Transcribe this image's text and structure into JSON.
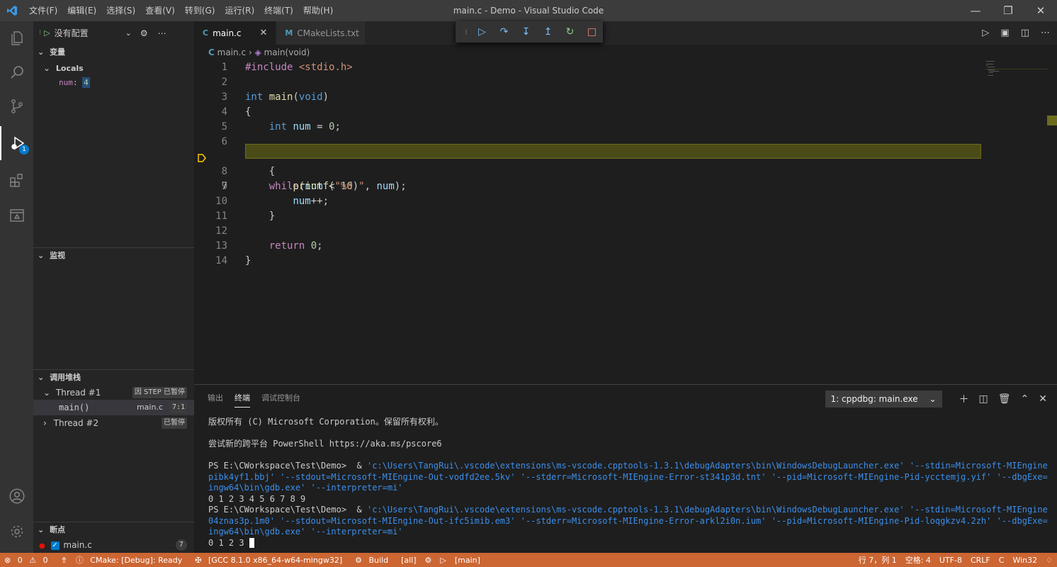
{
  "title_bar": {
    "menu": [
      "文件(F)",
      "编辑(E)",
      "选择(S)",
      "查看(V)",
      "转到(G)",
      "运行(R)",
      "终端(T)",
      "帮助(H)"
    ],
    "window_title": "main.c - Demo - Visual Studio Code"
  },
  "activity_bar": {
    "debug_badge": "1"
  },
  "sidebar": {
    "config_label": "没有配置",
    "variables_header": "变量",
    "locals_label": "Locals",
    "locals": [
      {
        "name": "num",
        "value": "4"
      }
    ],
    "watch_header": "监视",
    "callstack_header": "调用堆栈",
    "threads": [
      {
        "name": "Thread #1",
        "status": "因 STEP 已暂停"
      },
      {
        "name": "Thread #2",
        "status": "已暂停"
      }
    ],
    "frame": {
      "name": "main()",
      "file": "main.c",
      "pos": "7:1"
    },
    "breakpoints_header": "断点",
    "breakpoint": {
      "file": "main.c",
      "count": "7"
    }
  },
  "editor": {
    "tabs": [
      {
        "label": "main.c",
        "icon": "C"
      },
      {
        "label": "CMakeLists.txt",
        "icon": "M"
      }
    ],
    "breadcrumb": {
      "file": "main.c",
      "symbol": "main(void)"
    },
    "line_numbers": [
      "1",
      "2",
      "3",
      "4",
      "5",
      "6",
      "7",
      "8",
      "9",
      "10",
      "11",
      "12",
      "13",
      "14"
    ],
    "current_line": "7"
  },
  "panel": {
    "tabs": [
      "输出",
      "终端",
      "调试控制台"
    ],
    "active_tab": "终端",
    "terminal_select": "1: cppdbg: main.exe",
    "terminal_lines": [
      {
        "text": "版权所有 (C) Microsoft Corporation。保留所有权利。",
        "color": "plain"
      },
      {
        "text": "",
        "color": "plain"
      },
      {
        "text": "尝试新的跨平台 PowerShell https://aka.ms/pscore6",
        "color": "plain"
      },
      {
        "text": "",
        "color": "plain"
      },
      {
        "prompt": "PS E:\\CWorkspace\\Test\\Demo>  & ",
        "text": "'c:\\Users\\TangRui\\.vscode\\extensions\\ms-vscode.cpptools-1.3.1\\debugAdapters\\bin\\WindowsDebugLauncher.exe' '--stdin=Microsoft-MIEngine-In-",
        "color": "blue"
      },
      {
        "text": "pibk4yf1.bbj' '--stdout=Microsoft-MIEngine-Out-vodfd2ee.5kv' '--stderr=Microsoft-MIEngine-Error-st341p3d.tnt' '--pid=Microsoft-MIEngine-Pid-ycctemjg.yif' '--dbgExe=D:\\m",
        "color": "blue"
      },
      {
        "text": "ingw64\\bin\\gdb.exe' '--interpreter=mi'",
        "color": "blue"
      },
      {
        "text": "0 1 2 3 4 5 6 7 8 9",
        "color": "plain"
      },
      {
        "prompt": "PS E:\\CWorkspace\\Test\\Demo>  & ",
        "text": "'c:\\Users\\TangRui\\.vscode\\extensions\\ms-vscode.cpptools-1.3.1\\debugAdapters\\bin\\WindowsDebugLauncher.exe' '--stdin=Microsoft-MIEngine-In-",
        "color": "blue"
      },
      {
        "text": "04znas3p.1m0' '--stdout=Microsoft-MIEngine-Out-ifc5imib.em3' '--stderr=Microsoft-MIEngine-Error-arkl2i0n.ium' '--pid=Microsoft-MIEngine-Pid-loqgkzv4.2zh' '--dbgExe=D:\\m",
        "color": "blue"
      },
      {
        "text": "ingw64\\bin\\gdb.exe' '--interpreter=mi'",
        "color": "blue"
      },
      {
        "text": "0 1 2 3 ",
        "color": "plain"
      }
    ]
  },
  "status_bar": {
    "errors": "0",
    "warnings": "0",
    "cmake": "CMake: [Debug]: Ready",
    "kit": "[GCC 8.1.0 x86_64-w64-mingw32]",
    "build": "Build",
    "target": "[all]",
    "launch_target": "[main]",
    "position": "行 7，列 1",
    "spaces": "空格: 4",
    "encoding": "UTF-8",
    "eol": "CRLF",
    "language": "C",
    "platform": "Win32"
  },
  "colors": {
    "status_bg": "#cc6633",
    "debug_line_bg": "#4b4b18",
    "accent": "#007acc"
  }
}
